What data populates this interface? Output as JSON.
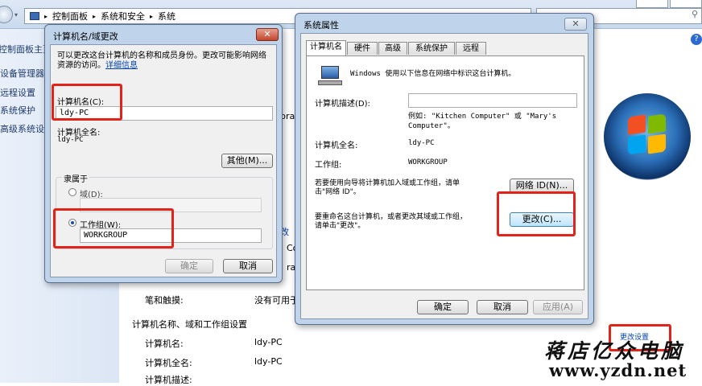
{
  "breadcrumb": {
    "items": [
      "控制面板",
      "系统和安全",
      "系统"
    ],
    "separator": "▸"
  },
  "left_panel": {
    "links": [
      "控制面板主页",
      "设备管理器",
      "远程设置",
      "系统保护",
      "高级系统设置"
    ]
  },
  "background_main": {
    "pen_touch_label": "笔和触摸:",
    "pen_touch_value": "没有可用于",
    "section_title": "计算机名称、域和工作组设置",
    "rows": [
      {
        "label": "计算机名:",
        "value": "ldy-PC"
      },
      {
        "label": "计算机全名:",
        "value": "ldy-PC"
      },
      {
        "label": "计算机描述:",
        "value": ""
      }
    ],
    "partial_texts": [
      "bra",
      "改",
      "Co",
      "ra"
    ],
    "change_settings_link": "更改设置"
  },
  "name_dialog": {
    "title": "计算机名/域更改",
    "close_glyph": "✕",
    "intro": "可以更改这台计算机的名称和成员身份。更改可能影响网络资源的访问。",
    "more_info_link": "详细信息",
    "computer_name_label": "计算机名(C):",
    "computer_name_value": "ldy-PC",
    "full_name_label": "计算机全名:",
    "full_name_value": "ldy-PC",
    "other_button": "其他(M)...",
    "member_of_label": "隶属于",
    "domain_label": "域(D):",
    "domain_value": "",
    "workgroup_label": "工作组(W):",
    "workgroup_value": "WORKGROUP",
    "ok_button": "确定",
    "cancel_button": "取消"
  },
  "sysprop_dialog": {
    "title": "系统属性",
    "close_glyph": "✕",
    "tabs": [
      "计算机名",
      "硬件",
      "高级",
      "系统保护",
      "远程"
    ],
    "active_tab": "计算机名",
    "intro": "Windows 使用以下信息在网络中标识这台计算机。",
    "description_label": "计算机描述(D):",
    "description_value": "",
    "example_line1": "例如: \"Kitchen Computer\" 或 \"Mary's",
    "example_line2": "Computer\"。",
    "full_name_label": "计算机全名:",
    "full_name_value": "ldy-PC",
    "workgroup_label": "工作组:",
    "workgroup_value": "WORKGROUP",
    "network_id_text1": "若要使用向导将计算机加入域或工作组，请单",
    "network_id_text2": "击\"网络 ID\"。",
    "network_id_button": "网络 ID(N)...",
    "rename_text1": "要重命名这台计算机，或者更改其域或工作组，",
    "rename_text2": "请单击\"更改\"。",
    "change_button": "更改(C)...",
    "ok_button": "确定",
    "cancel_button": "取消",
    "apply_button": "应用(A)"
  },
  "watermark": {
    "line1": "蒋店亿众电脑",
    "line2": "www.yzdn.net"
  },
  "colors": {
    "highlight_red": "#e2231a",
    "dialog_frame": "#bfd3ea",
    "link_blue": "#0645ad"
  }
}
